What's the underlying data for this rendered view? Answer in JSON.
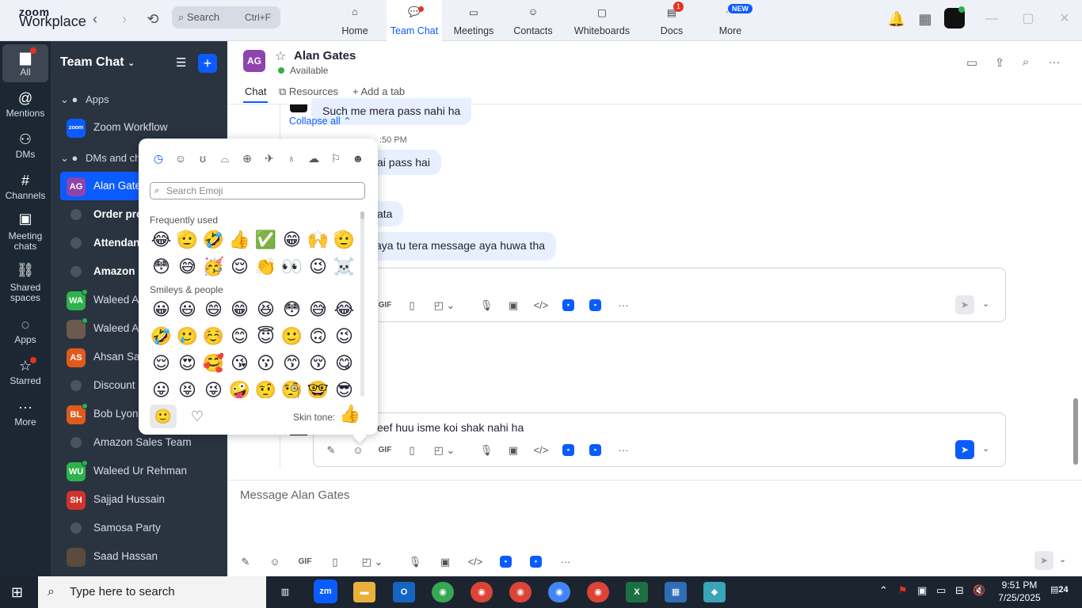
{
  "top": {
    "logo_line1": "zoom",
    "logo_line2": "Workplace",
    "search_label": "Search",
    "search_shortcut": "Ctrl+F",
    "tabs": [
      {
        "label": "Home"
      },
      {
        "label": "Team Chat"
      },
      {
        "label": "Meetings"
      },
      {
        "label": "Contacts"
      },
      {
        "label": "Whiteboards"
      },
      {
        "label": "Docs",
        "badge": "1"
      },
      {
        "label": "More",
        "badge": "NEW"
      }
    ]
  },
  "rail": {
    "items": [
      {
        "label": "All"
      },
      {
        "label": "Mentions"
      },
      {
        "label": "DMs"
      },
      {
        "label": "Channels"
      },
      {
        "label": "Meeting chats"
      },
      {
        "label": "Shared spaces"
      },
      {
        "label": "Apps"
      },
      {
        "label": "Starred"
      },
      {
        "label": "More"
      }
    ]
  },
  "sidebar": {
    "title": "Team Chat",
    "group_apps": "Apps",
    "group_dms": "DMs and ch",
    "items": [
      {
        "label": "Zoom Workflow",
        "avatar_text": "zoom",
        "avatar_color": "#0b5cff"
      },
      {
        "label": "Alan Gate",
        "avatar_text": "AG",
        "avatar_color": "#8e44ad"
      },
      {
        "label": "Order pro",
        "avatar_text": ""
      },
      {
        "label": "Attendan",
        "avatar_text": ""
      },
      {
        "label": "Amazon I",
        "avatar_text": ""
      },
      {
        "label": "Waleed A",
        "avatar_text": "WA",
        "avatar_color": "#2cb34a"
      },
      {
        "label": "Waleed A",
        "avatar_text": "",
        "avatar_color": "#6b5a4e"
      },
      {
        "label": "Ahsan Sa",
        "avatar_text": "AS",
        "avatar_color": "#e05a1c"
      },
      {
        "label": "Discount",
        "avatar_text": ""
      },
      {
        "label": "Bob Lyon",
        "avatar_text": "BL",
        "avatar_color": "#e05a1c"
      },
      {
        "label": "Amazon Sales Team",
        "avatar_text": ""
      },
      {
        "label": "Waleed Ur Rehman",
        "avatar_text": "WU",
        "avatar_color": "#2cb34a"
      },
      {
        "label": "Sajjad Hussain",
        "avatar_text": "SH",
        "avatar_color": "#d0332b"
      },
      {
        "label": "Samosa Party",
        "avatar_text": ""
      },
      {
        "label": "Saad Hassan",
        "avatar_text": "",
        "avatar_color": "#5b4a3e"
      }
    ]
  },
  "chat": {
    "avatar_text": "AG",
    "name": "Alan Gates",
    "status": "Available",
    "tab_chat": "Chat",
    "tab_resources": "Resources",
    "tab_add": "Add a tab",
    "collapse": "Collapse all",
    "time_partial": ":50 PM",
    "msg1": "Such me mera pass nahi ha",
    "msg2": "ai pass hai",
    "msg3": "ata",
    "msg4": "aya tu tera message aya huwa tha",
    "draft_text": "eef huu isme koi shak nahi ha",
    "compose_placeholder": "Message Alan Gates"
  },
  "emoji_picker": {
    "search_placeholder": "Search Emoji",
    "frequently_used": "Frequently used",
    "smileys_people": "Smileys & people",
    "skin_tone": "Skin tone:",
    "frequent": [
      "😂",
      "🫡",
      "🤣",
      "👍",
      "✅",
      "😁",
      "🙌",
      "🫡",
      "😳",
      "😅",
      "🥳",
      "😌",
      "👏",
      "👀",
      "😉",
      "☠️"
    ],
    "smileys": [
      "😀",
      "😃",
      "😄",
      "😁",
      "😆",
      "😳",
      "😅",
      "😂",
      "🤣",
      "🥲",
      "☺️",
      "😊",
      "😇",
      "🙂",
      "🙃",
      "😉",
      "😌",
      "😍",
      "🥰",
      "😘",
      "😗",
      "😙",
      "😚",
      "😋",
      "😛",
      "😝",
      "😜",
      "🤪",
      "🤨",
      "🧐",
      "🤓",
      "😎"
    ],
    "skin_emoji": "👍"
  },
  "taskbar": {
    "search_placeholder": "Type here to search",
    "time": "9:51 PM",
    "date": "7/25/2025",
    "notif_count": "24"
  },
  "colors": {
    "accent": "#0b5cff",
    "sidebar_bg": "#2a3441",
    "rail_bg": "#1b2733",
    "bubble_bg": "#e8f0ff"
  }
}
